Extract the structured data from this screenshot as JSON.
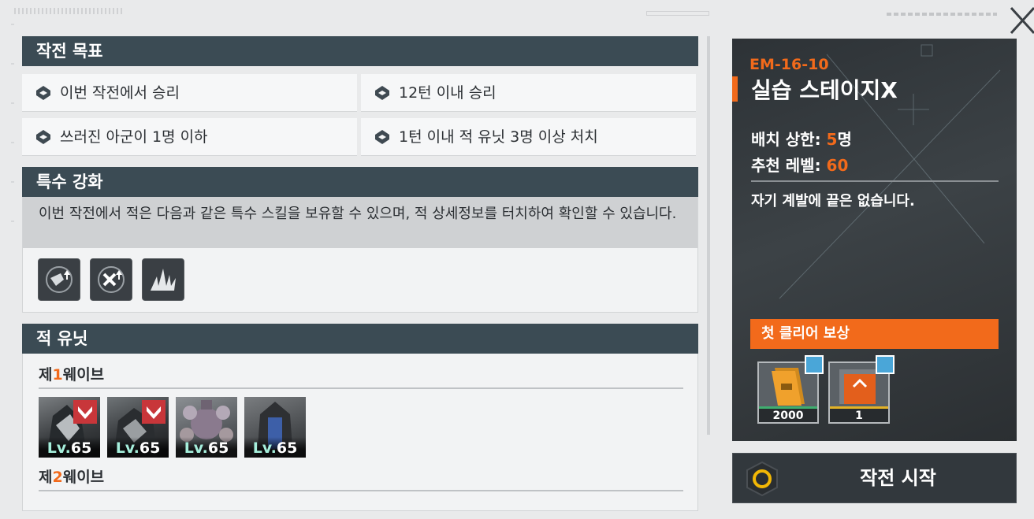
{
  "objectives": {
    "header": "작전 목표",
    "items": [
      "이번 작전에서 승리",
      "12턴 이내 승리",
      "쓰러진 아군이 1명 이하",
      "1턴 이내 적 유닛 3명 이상 처치"
    ]
  },
  "special": {
    "header": "특수 강화",
    "description": "이번 작전에서 적은 다음과 같은 특수 스킬을 보유할 수 있으며, 적 상세정보를 터치하여 확인할 수 있습니다.",
    "skills": [
      "speed-up-icon",
      "attack-up-icon",
      "spike-burst-icon"
    ]
  },
  "enemies": {
    "header": "적 유닛",
    "wave1": {
      "prefix": "제",
      "num": "1",
      "suffix": "웨이브"
    },
    "wave2": {
      "prefix": "제",
      "num": "2",
      "suffix": "웨이브"
    },
    "units": [
      {
        "lv_tag": "Lv.",
        "lv": "65"
      },
      {
        "lv_tag": "Lv.",
        "lv": "65"
      },
      {
        "lv_tag": "Lv.",
        "lv": "65"
      },
      {
        "lv_tag": "Lv.",
        "lv": "65"
      }
    ]
  },
  "stage": {
    "code": "EM-16-10",
    "name": "실습 스테이지X",
    "deploy_label": "배치 상한: ",
    "deploy_value": "5",
    "deploy_unit": "명",
    "level_label": "추천 레벨: ",
    "level_value": "60",
    "description": "자기 계발에 끝은 없습니다."
  },
  "rewards": {
    "header": "첫 클리어 보상",
    "items": [
      {
        "icon": "gold-bar-icon",
        "count": "2000"
      },
      {
        "icon": "data-chip-icon",
        "count": "1"
      }
    ]
  },
  "actions": {
    "start_label": "작전 시작"
  },
  "colors": {
    "accent": "#f26a1b",
    "header_bg": "#3b4b54"
  }
}
